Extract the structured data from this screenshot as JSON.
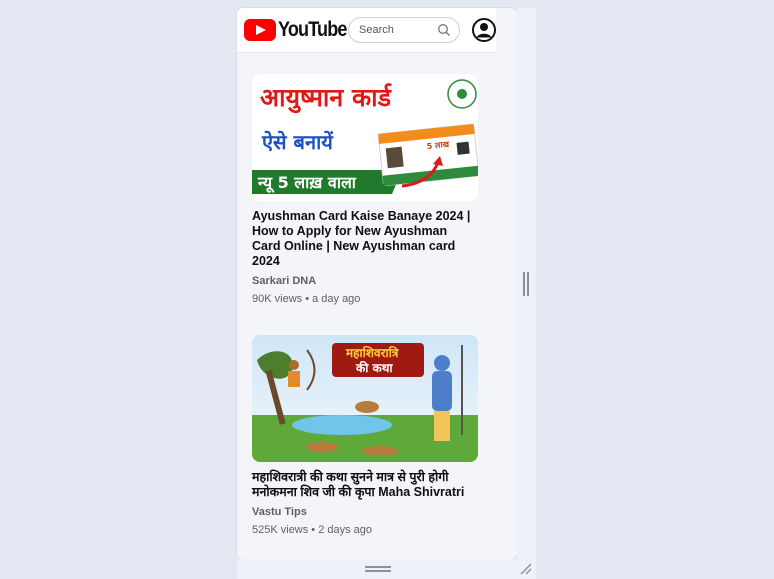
{
  "header": {
    "logo_text": "YouTube",
    "search_placeholder": "Search"
  },
  "videos": [
    {
      "title": "Ayushman Card Kaise Banaye 2024 | How to Apply for New Ayushman Card Online | New Ayushman card 2024",
      "channel": "Sarkari DNA",
      "meta": "90K views • a day ago",
      "thumb_text": {
        "line1": "आयुष्मान कार्ड",
        "line2": "ऐसे बनायें",
        "line3": "न्यू 5 लाख़ वाला",
        "card_label": "5 लाख"
      }
    },
    {
      "title": "महाशिवरात्री की कथा सुनने मात्र से पुरी होगी मनोकमना शिव जी की कृपा Maha Shivratri",
      "channel": "Vastu Tips",
      "meta": "525K views • 2 days ago",
      "thumb_text": {
        "banner1": "महाशिवरात्रि",
        "banner2": "की कथा"
      }
    }
  ],
  "colors": {
    "brand_red": "#ff0000",
    "title_red": "#e01919",
    "title_blue": "#1d4fc4",
    "green_band": "#1f7a2c"
  }
}
